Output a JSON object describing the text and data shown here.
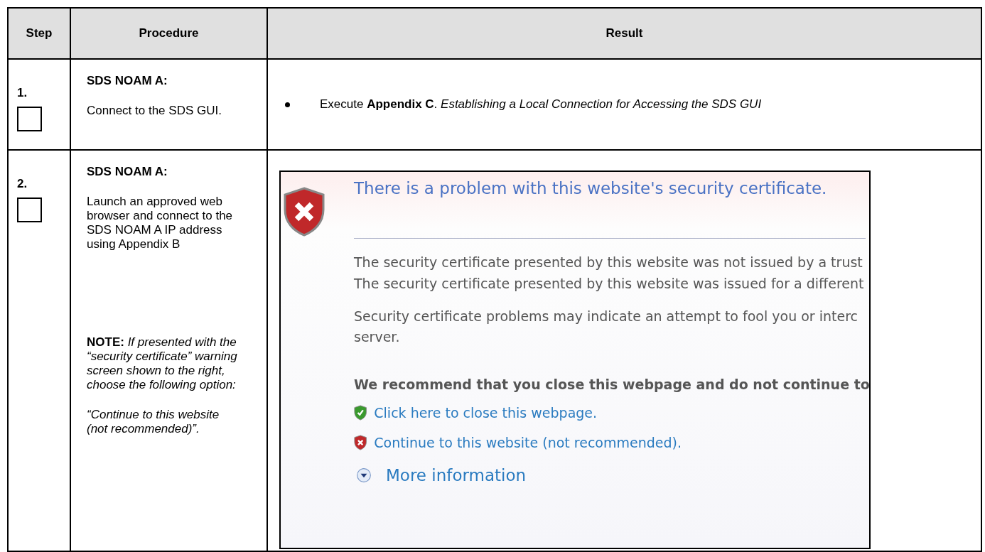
{
  "table": {
    "columns": [
      "Step",
      "Procedure",
      "Result"
    ],
    "rows": [
      {
        "step": "1.",
        "checked": false,
        "procedure": [
          {
            "kind": "heading",
            "text": "SDS NOAM A:"
          },
          {
            "kind": "plain",
            "text": "Connect to the SDS GUI."
          }
        ],
        "result": {
          "kind": "bullet",
          "text": "Execute **Appendix C**.  *Establishing a Local Connection for Accessing the SDS GUI*"
        }
      },
      {
        "step": "2.",
        "checked": false,
        "procedure": [
          {
            "kind": "heading",
            "text": "SDS NOAM A:"
          },
          {
            "kind": "plain",
            "text": "Launch an approved web browser and connect to the SDS NOAM A IP address using Appendix B"
          },
          {
            "kind": "note",
            "text": "**NOTE:**  *If presented with the “security certificate” warning screen shown to the right, choose the following option:*"
          },
          {
            "kind": "italic",
            "text": "“Continue to this website (not recommended)”."
          }
        ],
        "result": {
          "kind": "screenshot",
          "title": "There is a problem with this website's security certificate.",
          "lines": [
            "The security certificate presented by this website was not issued by a trust",
            "The security certificate presented by this website was issued for a different"
          ],
          "paragraph": [
            "Security certificate problems may indicate an attempt to fool you or interc",
            "server."
          ],
          "warning": "We recommend that you close this webpage and do not continue to",
          "links": [
            {
              "kind": "safe",
              "text": "Click here to close this webpage."
            },
            {
              "kind": "unsafe",
              "text": "Continue to this website (not recommended)."
            }
          ],
          "more": "More information"
        }
      }
    ]
  }
}
